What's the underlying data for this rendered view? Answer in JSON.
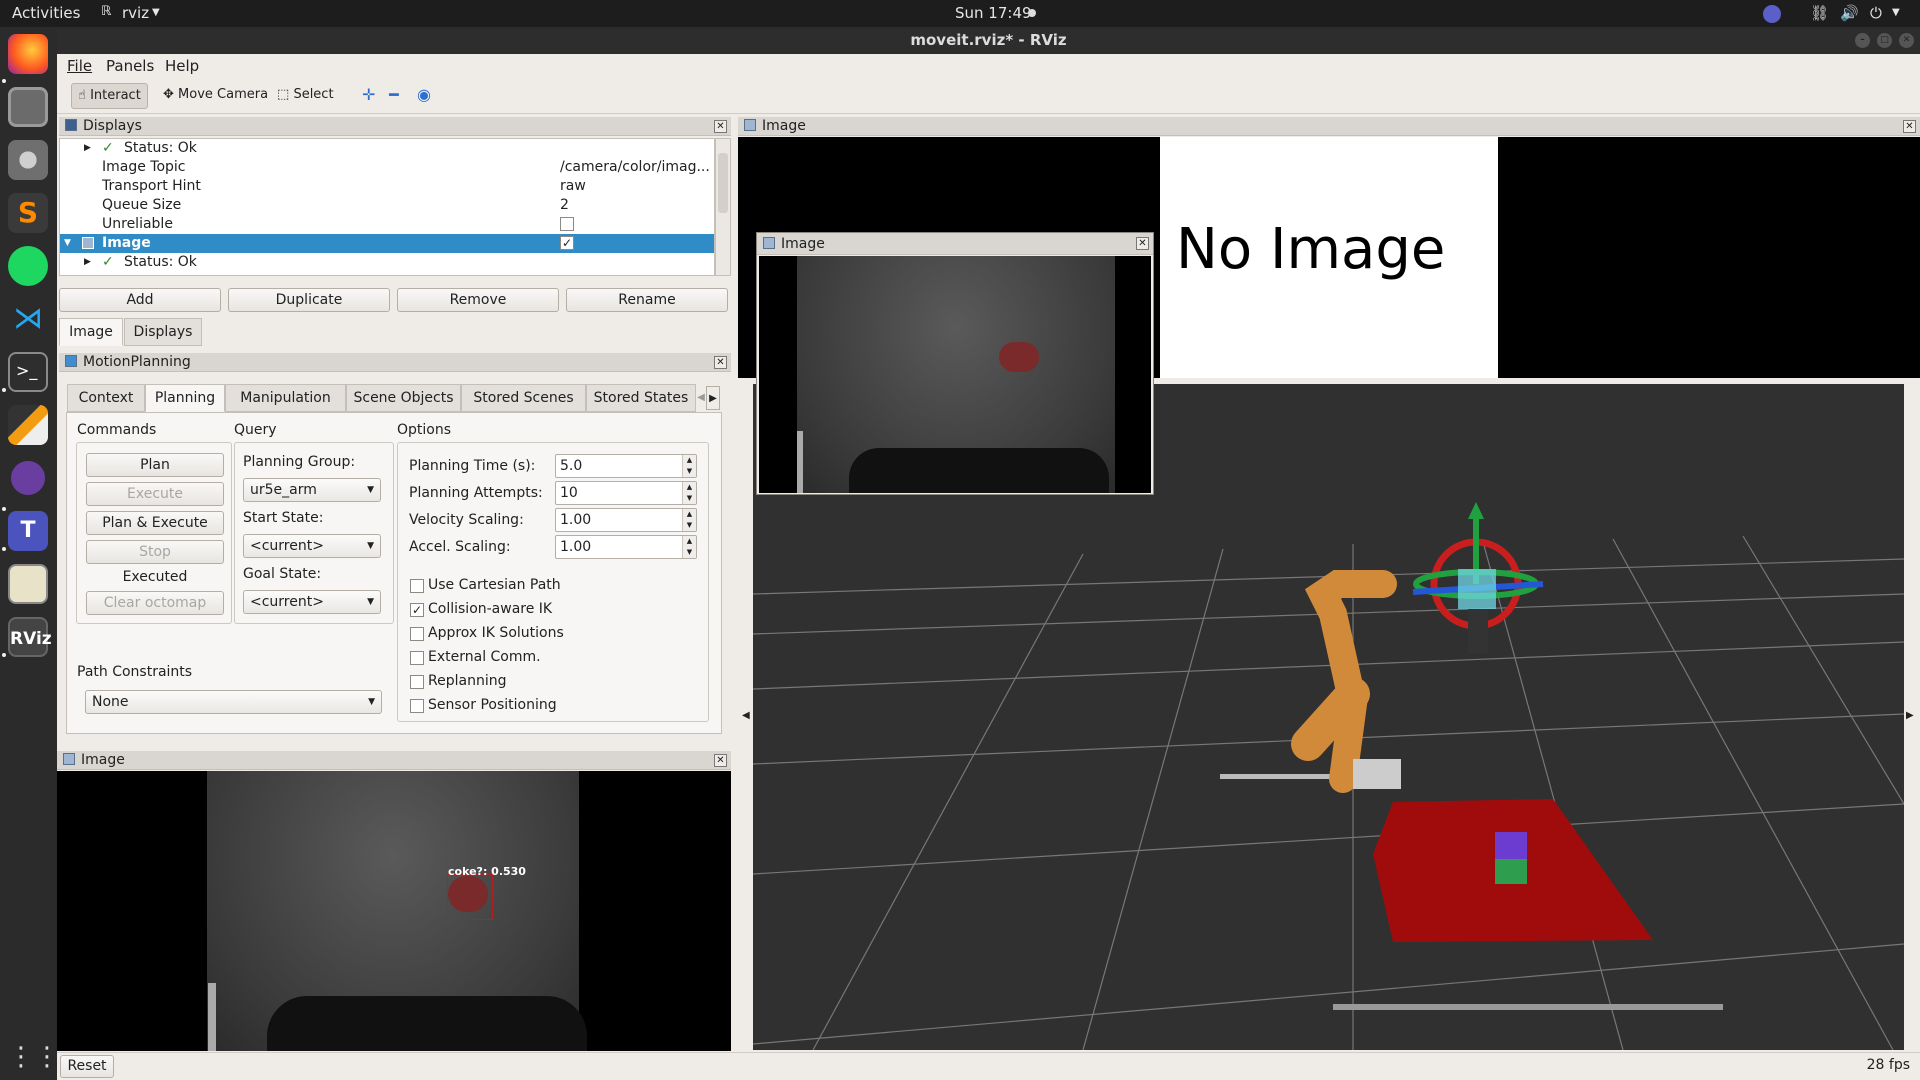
{
  "topbar": {
    "activities": "Activities",
    "app": "rviz",
    "clock": "Sun 17:49"
  },
  "window": {
    "title": "moveit.rviz* - RViz"
  },
  "menu": [
    "File",
    "Panels",
    "Help"
  ],
  "toolbar": {
    "interact": "Interact",
    "move_camera": "Move Camera",
    "select": "Select"
  },
  "displays_panel": {
    "title": "Displays",
    "rows": [
      {
        "name": "Status: Ok",
        "value": ""
      },
      {
        "name": "Image Topic",
        "value": "/camera/color/imag..."
      },
      {
        "name": "Transport Hint",
        "value": "raw"
      },
      {
        "name": "Queue Size",
        "value": "2"
      },
      {
        "name": "Unreliable",
        "value": ""
      },
      {
        "name": "Image",
        "value": ""
      },
      {
        "name": "Status: Ok",
        "value": ""
      }
    ],
    "buttons": {
      "add": "Add",
      "duplicate": "Duplicate",
      "remove": "Remove",
      "rename": "Rename"
    },
    "bottom_tabs": [
      "Image",
      "Displays"
    ]
  },
  "motion_planning": {
    "title": "MotionPlanning",
    "tabs": [
      "Context",
      "Planning",
      "Manipulation",
      "Scene Objects",
      "Stored Scenes",
      "Stored States"
    ],
    "commands": {
      "heading": "Commands",
      "plan": "Plan",
      "execute": "Execute",
      "plan_execute": "Plan & Execute",
      "stop": "Stop",
      "status": "Executed",
      "clear_octomap": "Clear octomap"
    },
    "query": {
      "heading": "Query",
      "planning_group_label": "Planning Group:",
      "planning_group": "ur5e_arm",
      "start_state_label": "Start State:",
      "start_state": "<current>",
      "goal_state_label": "Goal State:",
      "goal_state": "<current>"
    },
    "options": {
      "heading": "Options",
      "planning_time_label": "Planning Time (s):",
      "planning_time": "5.0",
      "planning_attempts_label": "Planning Attempts:",
      "planning_attempts": "10",
      "velocity_scaling_label": "Velocity Scaling:",
      "velocity_scaling": "1.00",
      "accel_scaling_label": "Accel. Scaling:",
      "accel_scaling": "1.00",
      "checks": [
        {
          "label": "Use Cartesian Path",
          "checked": false
        },
        {
          "label": "Collision-aware IK",
          "checked": true
        },
        {
          "label": "Approx IK Solutions",
          "checked": false
        },
        {
          "label": "External Comm.",
          "checked": false
        },
        {
          "label": "Replanning",
          "checked": false
        },
        {
          "label": "Sensor Positioning",
          "checked": false
        }
      ]
    },
    "path_constraints": {
      "label": "Path Constraints",
      "value": "None"
    }
  },
  "image_panel_bottom": {
    "title": "Image",
    "detection": "coke?: 0.530"
  },
  "image_panel_top": {
    "title": "Image",
    "no_image": "No Image"
  },
  "floating_image": {
    "title": "Image"
  },
  "status": {
    "reset": "Reset",
    "fps": "28 fps"
  }
}
